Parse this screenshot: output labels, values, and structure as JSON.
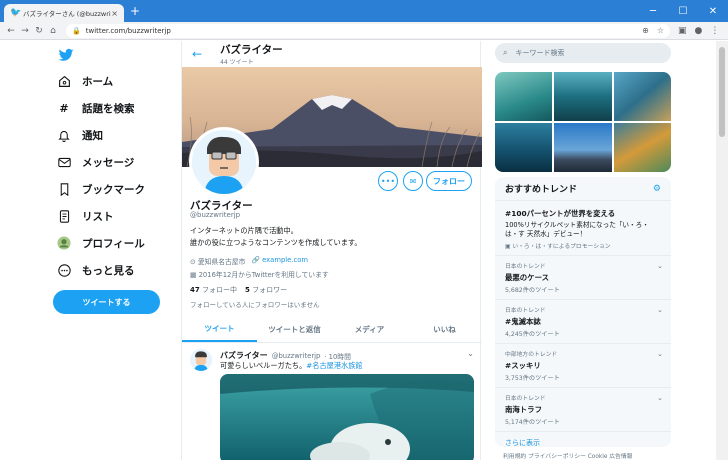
{
  "browser": {
    "tab_title": "バズライターさん (@buzzwriterjp) / T",
    "tab_close": "×",
    "new_tab": "+",
    "url": "twitter.com/buzzwriterjp",
    "win_min": "─",
    "win_max": "☐",
    "win_close": "✕"
  },
  "nav": {
    "items": [
      {
        "label": "ホーム",
        "icon": "home-icon"
      },
      {
        "label": "話題を検索",
        "icon": "hash-icon"
      },
      {
        "label": "通知",
        "icon": "bell-icon"
      },
      {
        "label": "メッセージ",
        "icon": "mail-icon"
      },
      {
        "label": "ブックマーク",
        "icon": "bookmark-icon"
      },
      {
        "label": "リスト",
        "icon": "list-icon"
      },
      {
        "label": "プロフィール",
        "icon": "profile-icon"
      },
      {
        "label": "もっと見る",
        "icon": "more-icon"
      }
    ],
    "tweet_button": "ツイートする"
  },
  "profile": {
    "header_name": "バズライター",
    "header_count": "44 ツイート",
    "name": "バズライター",
    "handle": "@buzzwriterjp",
    "bio_line1": "インターネットの片隅で活動中。",
    "bio_line2": "誰かの役に立つようなコンテンツを作成しています。",
    "location": "愛知県名古屋市",
    "link": "example.com",
    "joined": "2016年12月からTwitterを利用しています",
    "following_count": "47",
    "following_label": "フォロー中",
    "followers_count": "5",
    "followers_label": "フォロワー",
    "follow_note": "フォローしている人にフォロワーはいません",
    "follow_button": "フォロー"
  },
  "tabs": [
    "ツイート",
    "ツイートと返信",
    "メディア",
    "いいね"
  ],
  "tweet": {
    "name": "バズライター",
    "handle": "@buzzwriterjp",
    "time": "· 10時間",
    "text": "可愛らしいベルーガたち。",
    "hashtag": "#名古屋港水族館"
  },
  "search": {
    "placeholder": "キーワード検索"
  },
  "trends": {
    "title": "おすすめトレンド",
    "items": [
      {
        "name": "#100パーセントが世界を変える",
        "desc": "100%リサイクルペット素材になった「い・ろ・は・す 天然水」デビュー！",
        "promo": "い・ろ・は・すによるプロモーション"
      },
      {
        "category": "日本のトレンド",
        "name": "最悪のケース",
        "count": "5,682件のツイート"
      },
      {
        "category": "日本のトレンド",
        "name": "#鬼滅本誌",
        "count": "4,245件のツイート"
      },
      {
        "category": "中部地方のトレンド",
        "name": "#スッキリ",
        "count": "3,753件のツイート"
      },
      {
        "category": "日本のトレンド",
        "name": "南海トラフ",
        "count": "5,174件のツイート"
      }
    ],
    "more": "さらに表示"
  },
  "footer": "利用規約  プライバシーポリシー  Cookie  広告情報",
  "colors": {
    "accent": "#1da1f2",
    "titlebar": "#2b7fd4"
  }
}
